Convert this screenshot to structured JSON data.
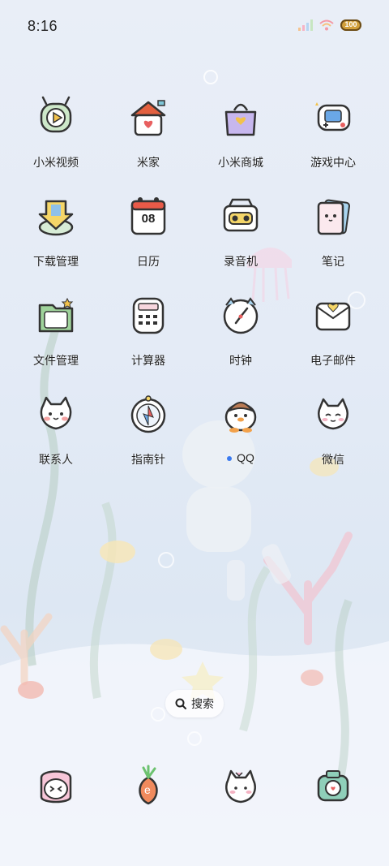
{
  "status_bar": {
    "time": "8:16",
    "battery_level": "100",
    "signal_icon": "signal-icon",
    "wifi_icon": "wifi-icon",
    "battery_icon": "battery-icon"
  },
  "apps": [
    {
      "label": "小米视频",
      "icon": "video-icon"
    },
    {
      "label": "米家",
      "icon": "home-icon"
    },
    {
      "label": "小米商城",
      "icon": "shopping-bag-icon"
    },
    {
      "label": "游戏中心",
      "icon": "gamepad-icon"
    },
    {
      "label": "下载管理",
      "icon": "download-icon"
    },
    {
      "label": "日历",
      "icon": "calendar-icon",
      "calendar_day": "08"
    },
    {
      "label": "录音机",
      "icon": "recorder-icon"
    },
    {
      "label": "笔记",
      "icon": "notes-icon"
    },
    {
      "label": "文件管理",
      "icon": "folder-icon"
    },
    {
      "label": "计算器",
      "icon": "calculator-icon"
    },
    {
      "label": "时钟",
      "icon": "clock-icon"
    },
    {
      "label": "电子邮件",
      "icon": "email-icon"
    },
    {
      "label": "联系人",
      "icon": "contacts-icon"
    },
    {
      "label": "指南针",
      "icon": "compass-icon"
    },
    {
      "label": "QQ",
      "icon": "qq-penguin-icon"
    },
    {
      "label": "微信",
      "icon": "wechat-cat-icon"
    }
  ],
  "search": {
    "label": "搜索",
    "icon": "search-icon"
  },
  "dock": [
    {
      "icon": "phone-cat-icon"
    },
    {
      "icon": "carrot-browser-icon"
    },
    {
      "icon": "bunny-messages-icon"
    },
    {
      "icon": "camera-icon"
    }
  ],
  "colors": {
    "accent": "#3a7af0",
    "background": "#e6ecf6"
  }
}
